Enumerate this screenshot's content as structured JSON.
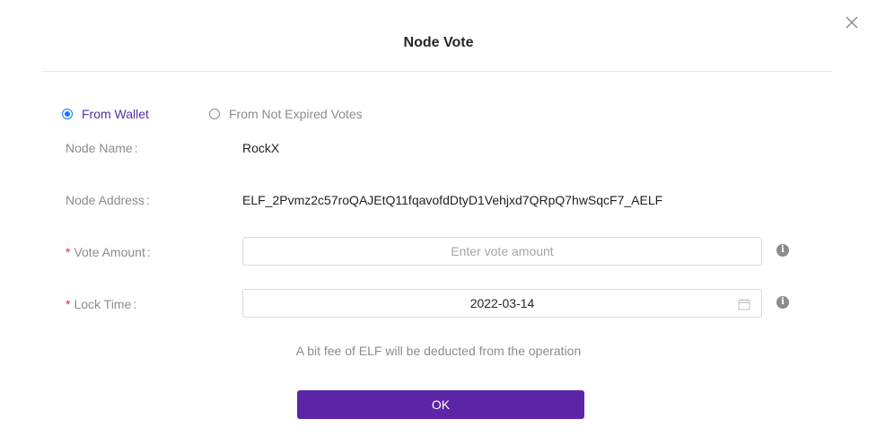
{
  "modal": {
    "title": "Node Vote",
    "close_icon": "close-icon"
  },
  "source": {
    "options": [
      {
        "label": "From Wallet",
        "selected": true
      },
      {
        "label": "From Not Expired Votes",
        "selected": false
      }
    ]
  },
  "form": {
    "node_name_label": "Node Name",
    "node_name_value": "RockX",
    "node_address_label": "Node Address",
    "node_address_value": "ELF_2Pvmz2c57roQAJEtQ11fqavofdDtyD1Vehjxd7QRpQ7hwSqcF7_AELF",
    "vote_amount_label": "Vote Amount",
    "vote_amount_placeholder": "Enter vote amount",
    "vote_amount_value": "",
    "lock_time_label": "Lock Time",
    "lock_time_value": "2022-03-14",
    "required_mark": "*",
    "label_suffix": ":"
  },
  "fee_note": "A bit fee of ELF will be deducted from the operation",
  "ok_label": "OK",
  "colors": {
    "primary": "#5b25a6",
    "radio_blue": "#1677ff",
    "required_red": "#f5222d"
  }
}
